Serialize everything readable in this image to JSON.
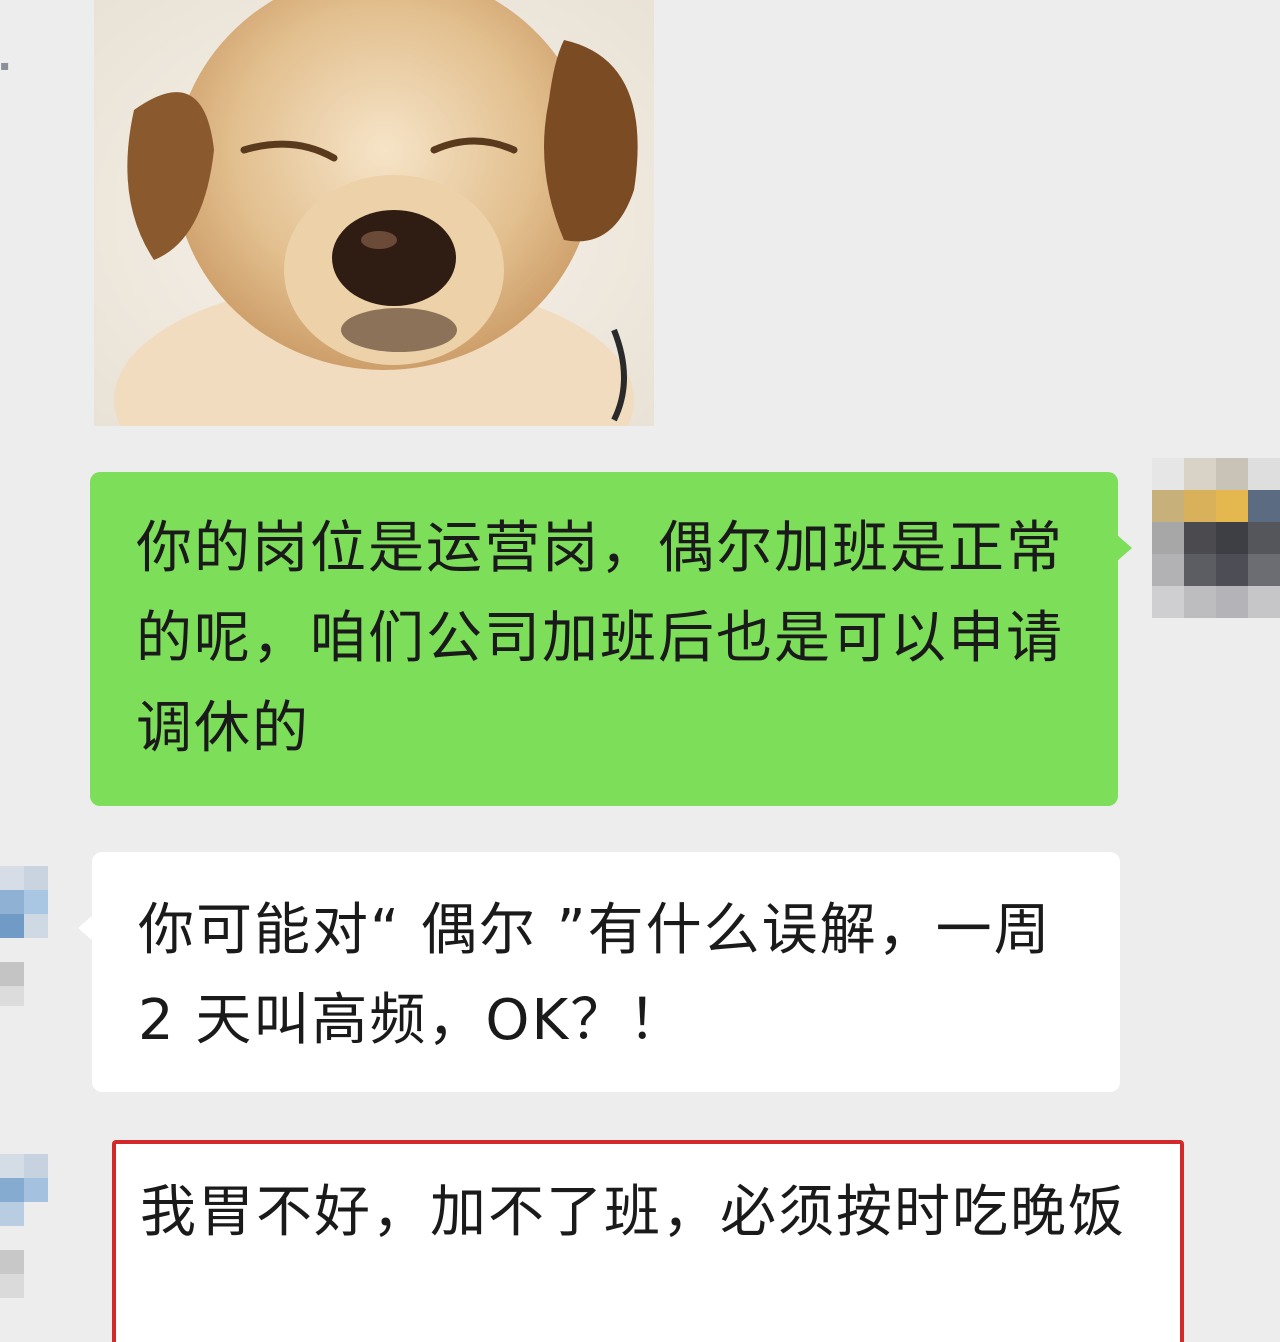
{
  "conversation": {
    "messages": [
      {
        "sender": "other",
        "type": "sticker",
        "icon": "dog-sticker"
      },
      {
        "sender": "self",
        "type": "text",
        "text": "你的岗位是运营岗，偶尔加班是正常的呢，咱们公司加班后也是可以申请调休的"
      },
      {
        "sender": "other",
        "type": "text",
        "text": "你可能对“ 偶尔 ”有什么误解，一周 2 天叫高频，OK？！"
      },
      {
        "sender": "other",
        "type": "text",
        "text": "我胃不好，加不了班，必须按时吃晚饭",
        "highlighted": true
      }
    ]
  },
  "colors": {
    "background": "#ededed",
    "sent_bubble": "#7dde5a",
    "received_bubble": "#ffffff",
    "highlight_border": "#d22a2a"
  }
}
